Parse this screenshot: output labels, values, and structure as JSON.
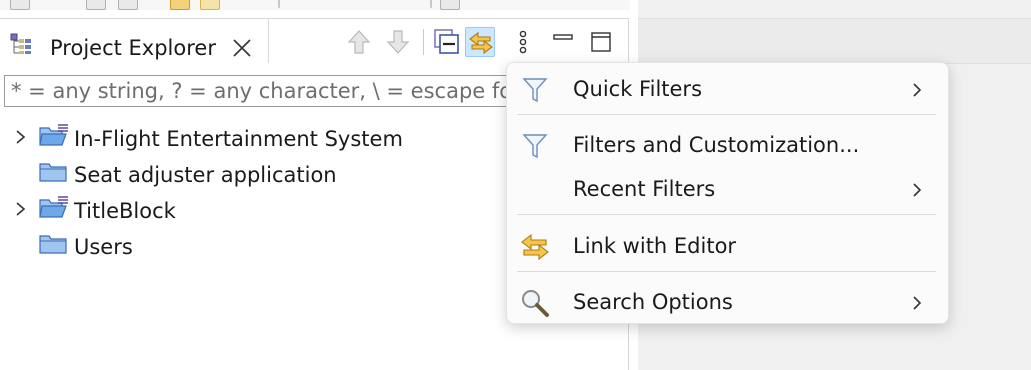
{
  "view": {
    "tab_title": "Project Explorer",
    "filter_placeholder": "* = any string, ? = any character, \\ = escape for literals: *?\\"
  },
  "toolbar": {
    "buttons": [
      "arrow-up-icon",
      "arrow-down-icon",
      "collapse-all-icon",
      "link-with-editor-icon",
      "view-menu-icon",
      "minimize-icon",
      "maximize-icon"
    ]
  },
  "tree": {
    "items": [
      {
        "label": "In-Flight Entertainment System",
        "expandable": true,
        "icon": "open-folder-icon"
      },
      {
        "label": "Seat adjuster application",
        "expandable": false,
        "icon": "folder-icon"
      },
      {
        "label": "TitleBlock",
        "expandable": true,
        "icon": "open-folder-icon"
      },
      {
        "label": "Users",
        "expandable": false,
        "icon": "folder-icon"
      }
    ]
  },
  "menu": {
    "items": [
      {
        "label": "Quick Filters",
        "icon": "filter-icon",
        "submenu": true
      },
      {
        "label": "Filters and Customization...",
        "icon": "filter-icon",
        "submenu": false
      },
      {
        "label": "Recent Filters",
        "icon": "",
        "submenu": true
      },
      {
        "label": "Link with Editor",
        "icon": "link-with-editor-icon",
        "submenu": false
      },
      {
        "label": "Search Options",
        "icon": "magnifier-icon",
        "submenu": true
      }
    ]
  },
  "colors": {
    "accent_selection": "#cce8ff",
    "folder_blue": "#6fa8e8",
    "link_orange": "#e0a020"
  }
}
